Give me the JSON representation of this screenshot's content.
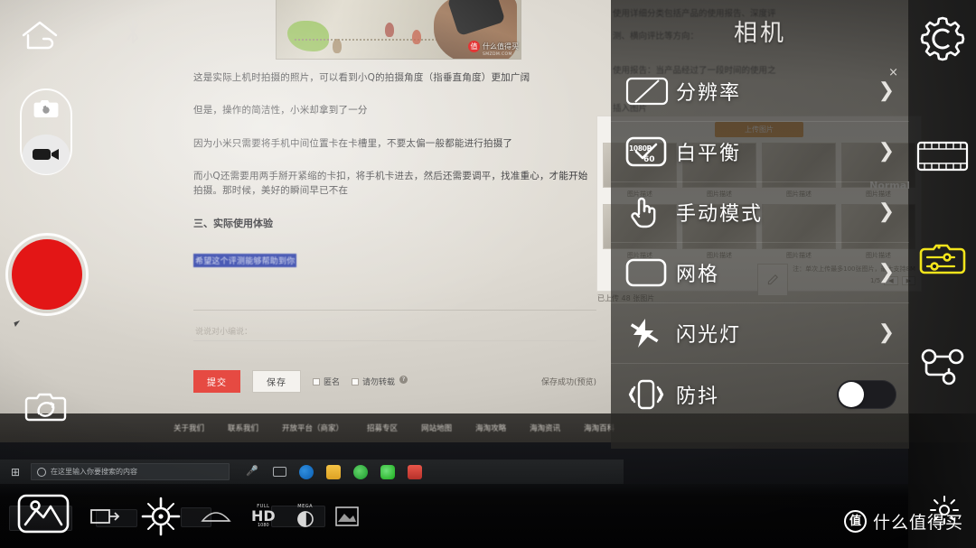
{
  "app": {
    "panel_title": "相机",
    "close_label": "×",
    "settings": [
      {
        "label": "分辨率",
        "icon": "resolution-1080p60-icon",
        "control": "chevron",
        "chevron": "❯"
      },
      {
        "label": "白平衡",
        "icon": "white-balance-check-icon",
        "control": "chevron",
        "chevron": "❯"
      },
      {
        "label": "手动模式",
        "icon": "manual-mode-hand-icon",
        "control": "chevron",
        "chevron": "❯"
      },
      {
        "label": "网格",
        "icon": "grid-icon",
        "control": "chevron",
        "chevron": "❯"
      },
      {
        "label": "闪光灯",
        "icon": "flash-off-icon",
        "control": "chevron",
        "chevron": "❯"
      },
      {
        "label": "防抖",
        "icon": "stabilization-icon",
        "control": "toggle",
        "toggle_on": false
      }
    ],
    "resolution_icon_text": {
      "top": "1080P",
      "bottom": "60"
    },
    "left_controls": {
      "home": "home-icon",
      "bluetooth": "bluetooth-icon",
      "mode_photo": "photo-mode-icon",
      "mode_video": "video-mode-icon",
      "mode_selected": "video",
      "shutter": "record-shutter-button",
      "selfie": "switch-camera-icon",
      "gallery": "gallery-icon"
    },
    "bottom_controls": [
      {
        "icon": "transfer-icon"
      },
      {
        "icon": "focus-target-icon"
      },
      {
        "icon": "exposure-icon"
      },
      {
        "icon": "hd-icon",
        "label": "HD",
        "sub": "FULL",
        "sub2": "1080"
      },
      {
        "icon": "mega-pixel-icon",
        "label": "MEGA"
      },
      {
        "icon": "burst-icon"
      }
    ],
    "right_rail": [
      {
        "icon": "gear-settings-icon",
        "active": false
      },
      {
        "icon": "normal-filter-icon",
        "active": false,
        "label": "Normal"
      },
      {
        "icon": "tune-adjust-icon",
        "active": true,
        "accent": "#f2e41c"
      },
      {
        "icon": "share-node-icon",
        "active": false
      }
    ],
    "watermark": {
      "logo": "值",
      "text": "什么值得买"
    }
  },
  "preview": {
    "article": {
      "paragraphs": [
        "这是实际上机时拍摄的照片，可以看到小Q的拍摄角度（指垂直角度）更加广阔",
        "但是，操作的简洁性，小米却拿到了一分",
        "因为小米只需要将手机中间位置卡在卡槽里，不要太偏一般都能进行拍摄了",
        "而小Q还需要用两手掰开紧缩的卡扣，将手机卡进去，然后还需要调平，找准重心，才能开始拍摄。那时候，美好的瞬间早已不在"
      ],
      "heading": "三、实际使用体验",
      "selected_text": "希望这个评测能够帮助到你",
      "comment_placeholder": "说说对小编说：",
      "photo_watermark": {
        "badge": "值",
        "text": "什么值得买",
        "sub": "SMZDM.COM"
      }
    },
    "form": {
      "submit": "提交",
      "save": "保存",
      "anonymous": "匿名",
      "no_reprint": "请勿转载",
      "help": "?",
      "status": "保存成功(预览)"
    },
    "footer_links": [
      "关于我们",
      "联系我们",
      "开放平台（商家）",
      "招募专区",
      "网站地图",
      "海淘攻略",
      "海淘资讯",
      "海淘百科"
    ],
    "upload": {
      "button": "上传图片",
      "captions": [
        "图片描述",
        "图片描述",
        "图片描述",
        "图片描述",
        "图片描述",
        "图片描述",
        "图片描述",
        "图片描述"
      ],
      "note": "注：单次上传最多100张图片，最大支持8M",
      "page": "1/5",
      "prev": "◀",
      "next": "▶",
      "uploaded": "已上传 48 张图片"
    },
    "right_text": [
      "使用详细分类包括产品的使用报告、深度评",
      "测、横向评比等方向：",
      "使用报告：当产品经过了一段时间的使用之",
      "插入图片"
    ],
    "taskbar": {
      "search_placeholder": "在这里输入你要搜索的内容"
    }
  }
}
